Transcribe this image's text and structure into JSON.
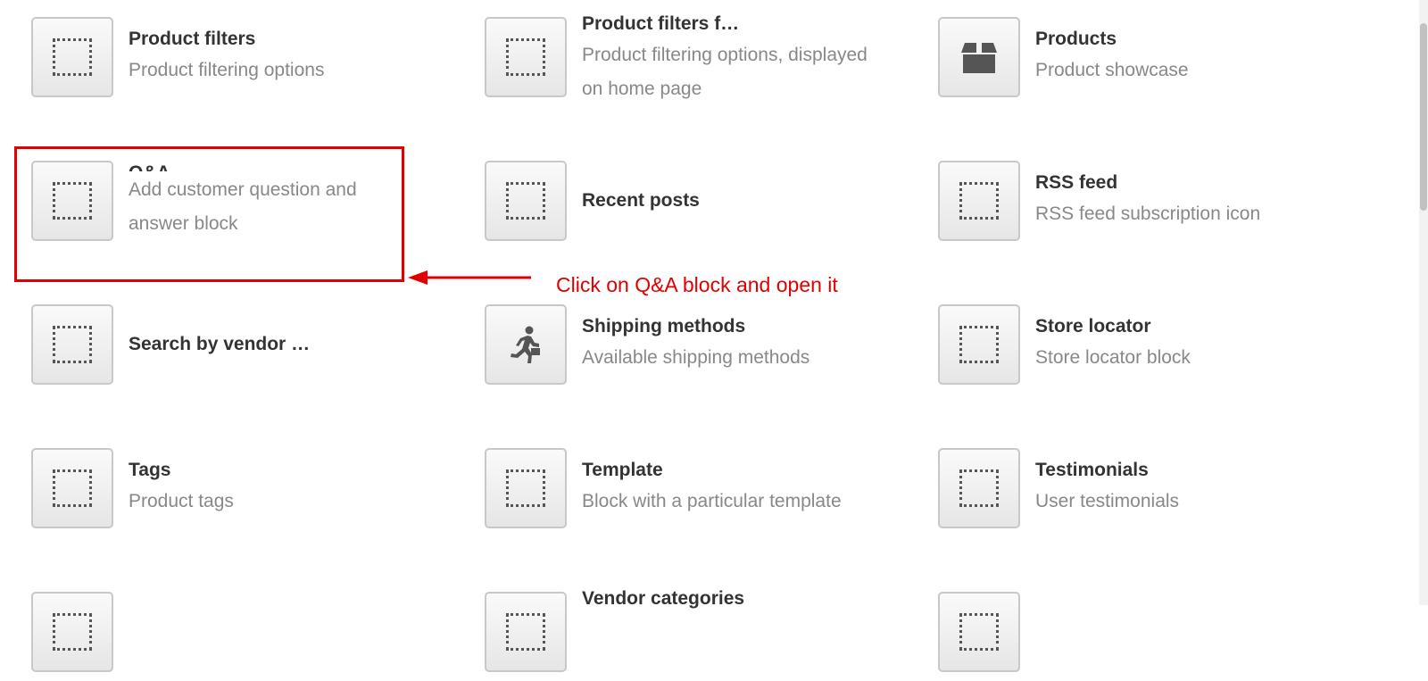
{
  "blocks": [
    {
      "title": "Product filters",
      "desc": "Product filtering options",
      "icon": "placeholder-icon"
    },
    {
      "title": "Product filters f…",
      "desc": "Product filtering options, displayed on home page",
      "icon": "placeholder-icon"
    },
    {
      "title": "Products",
      "desc": "Product showcase",
      "icon": "box-icon"
    },
    {
      "title": "Q&A",
      "desc": "Add customer question and answer block",
      "icon": "placeholder-icon"
    },
    {
      "title": "Recent posts",
      "desc": "",
      "icon": "placeholder-icon"
    },
    {
      "title": "RSS feed",
      "desc": "RSS feed subscription icon",
      "icon": "placeholder-icon"
    },
    {
      "title": "Search by vendor …",
      "desc": "",
      "icon": "placeholder-icon"
    },
    {
      "title": "Shipping methods",
      "desc": "Available shipping methods",
      "icon": "running-courier-icon"
    },
    {
      "title": "Store locator",
      "desc": "Store locator block",
      "icon": "placeholder-icon"
    },
    {
      "title": "Tags",
      "desc": "Product tags",
      "icon": "placeholder-icon"
    },
    {
      "title": "Template",
      "desc": "Block with a particular template",
      "icon": "placeholder-icon"
    },
    {
      "title": "Testimonials",
      "desc": "User testimonials",
      "icon": "placeholder-icon"
    },
    {
      "title": "",
      "desc": "",
      "icon": "placeholder-icon"
    },
    {
      "title": "Vendor categories",
      "desc": "",
      "icon": "placeholder-icon"
    },
    {
      "title": "",
      "desc": "",
      "icon": "placeholder-icon"
    }
  ],
  "annotation": {
    "text": "Click on Q&A block and open it",
    "color": "#e00000"
  }
}
